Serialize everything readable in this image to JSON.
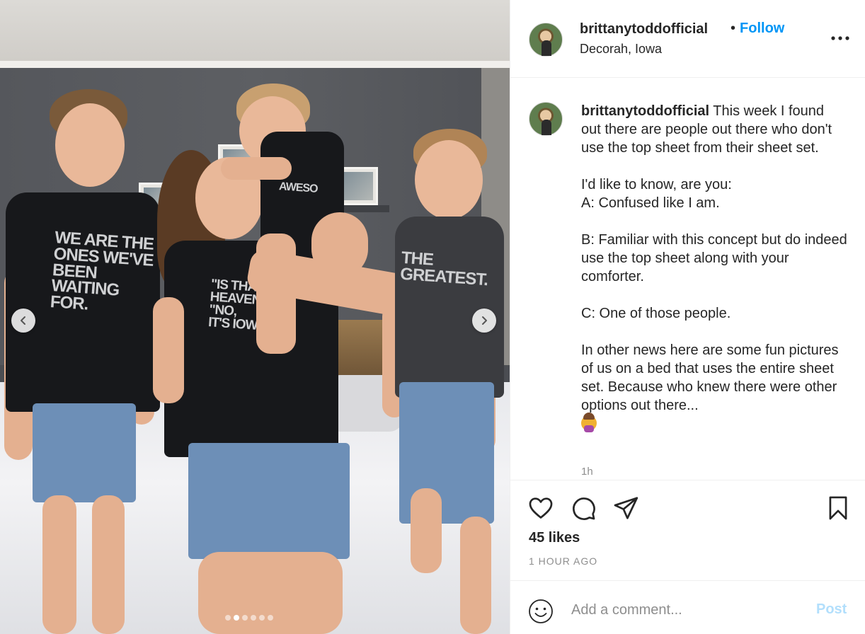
{
  "post": {
    "username": "brittanytoddofficial",
    "bullet": "•",
    "follow_label": "Follow",
    "location": "Decorah, Iowa",
    "more_icon": "more-horizontal-icon"
  },
  "photo": {
    "shirt_left": "WE ARE THE\nONES WE'VE\nBEEN\nWAITING\nFOR.",
    "shirt_mom": "\"IS THAT\nHEAVEN?\n\"NO,\nIT'S IOWA",
    "shirt_baby": "AWESO",
    "shirt_right": "THE\nGREATEST.",
    "carousel_dots": 6,
    "active_dot": 1
  },
  "caption": {
    "username": "brittanytoddofficial",
    "text": " This week I found out there are people out there who don't use the top sheet from their sheet set.\n\nI'd like to know, are you:\nA: Confused like I am.\n\nB: Familiar with this concept but do indeed use the top sheet along with your comforter.\n\nC: One of those people.\n\nIn other news here are some fun pictures of us on a bed that uses the entire sheet set. Because who knew there were other options out there...\n",
    "emoji": "person-shrugging-emoji",
    "time": "1h"
  },
  "actions": {
    "like_icon": "heart-icon",
    "comment_icon": "comment-icon",
    "share_icon": "share-icon",
    "save_icon": "bookmark-icon",
    "likes": "45 likes",
    "posted": "1 HOUR AGO"
  },
  "comment": {
    "placeholder": "Add a comment...",
    "post_label": "Post",
    "emoji_icon": "smiley-icon"
  },
  "colors": {
    "link": "#0095f6",
    "post_disabled": "#b2dffc",
    "muted": "#8e8e8e",
    "text": "#262626"
  }
}
